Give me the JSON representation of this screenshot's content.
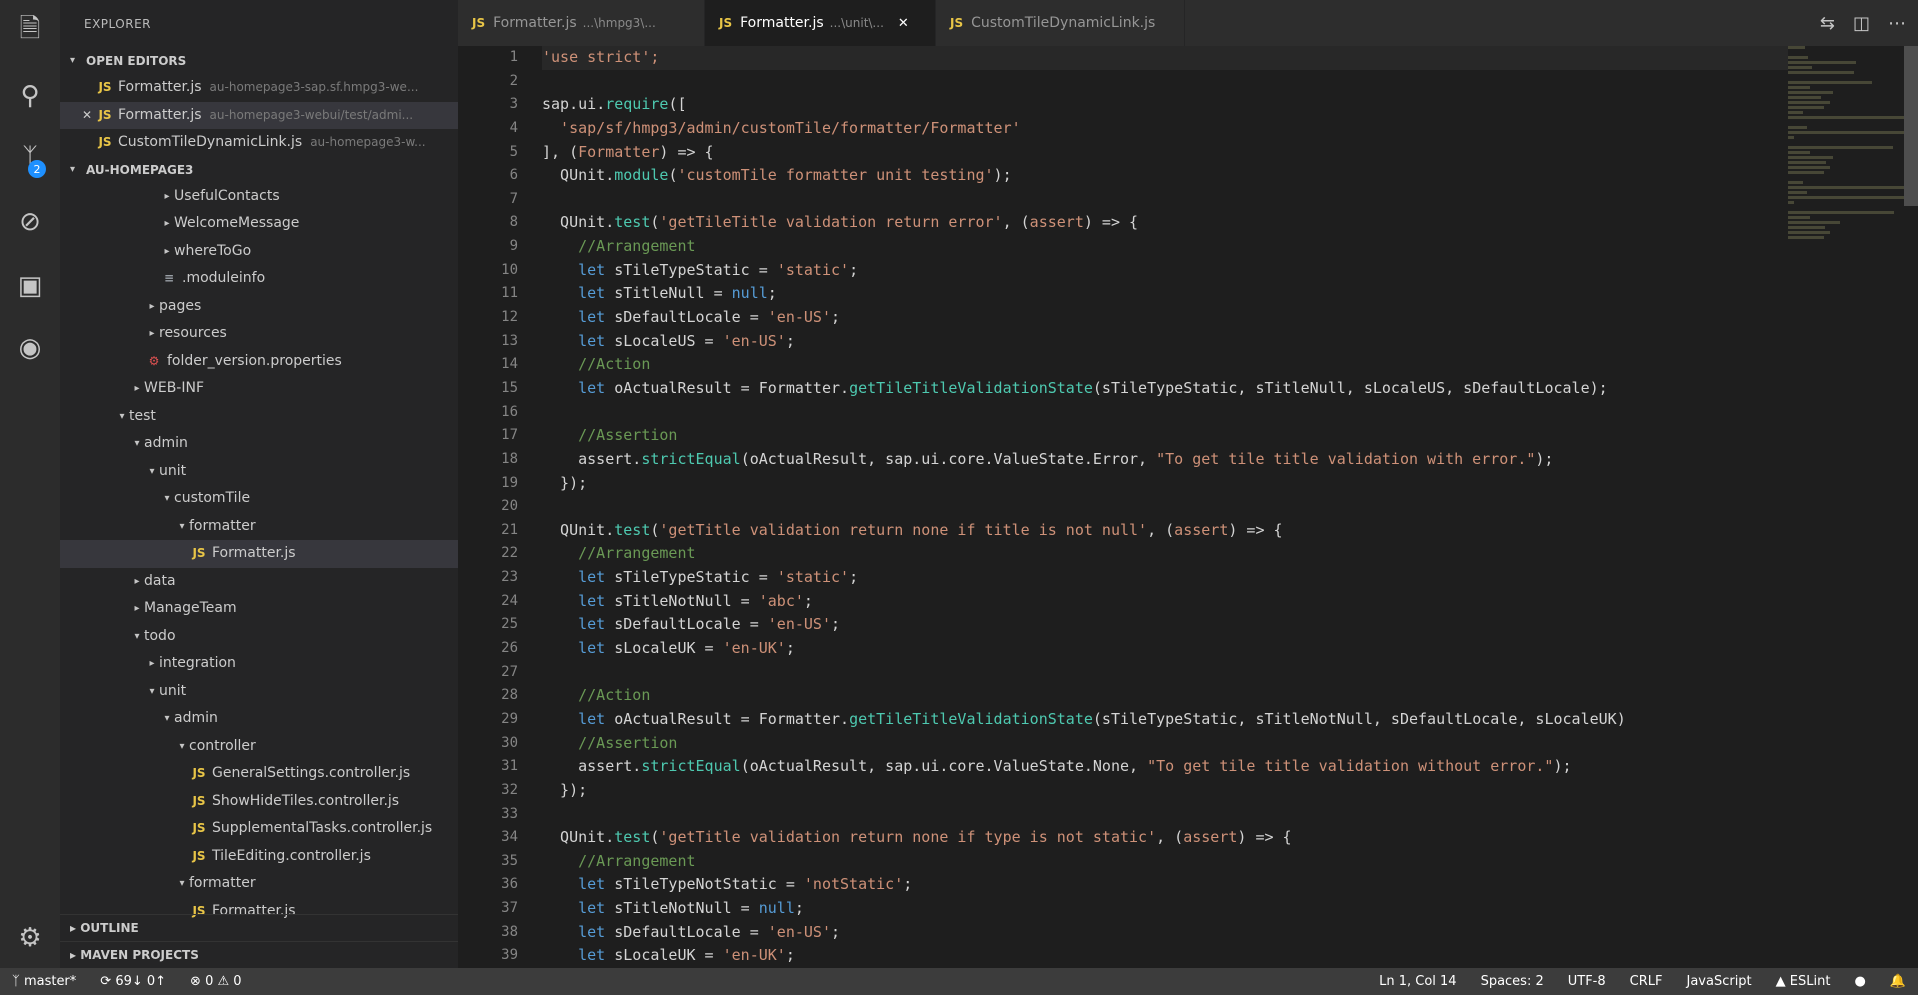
{
  "colors": {
    "keyword": "#569cd6",
    "string": "#ce9178",
    "function": "#dcdcaa",
    "method": "#4ec9b0",
    "param": "#ce9178",
    "comment": "#6a9955",
    "default": "#d4d4d4"
  },
  "activity_bar": {
    "icons": [
      "files-icon",
      "search-icon",
      "source-control-icon",
      "debug-icon",
      "extensions-icon",
      "remote-icon",
      "settings-gear-icon"
    ],
    "badge": "2"
  },
  "sidebar": {
    "title": "EXPLORER",
    "open_editors_label": "OPEN EDITORS",
    "open_editors": [
      {
        "name": "Formatter.js",
        "dir": "au-homepage3-sap.sf.hmpg3-we..."
      },
      {
        "name": "Formatter.js",
        "dir": "au-homepage3-webui/test/admi..."
      },
      {
        "name": "CustomTileDynamicLink.js",
        "dir": "au-homepage3-w..."
      }
    ],
    "project_label": "AU-HOMEPAGE3",
    "tree": [
      {
        "label": "UsefulContacts",
        "twisty": "▸"
      },
      {
        "label": "WelcomeMessage",
        "twisty": "▸"
      },
      {
        "label": "whereToGo",
        "twisty": "▸"
      },
      {
        "label": ".moduleinfo"
      },
      {
        "label": "pages",
        "twisty": "▸"
      },
      {
        "label": "resources",
        "twisty": "▸"
      },
      {
        "label": "folder_version.properties"
      },
      {
        "label": "WEB-INF",
        "twisty": "▸"
      },
      {
        "label": "test",
        "twisty": "▾"
      },
      {
        "label": "admin",
        "twisty": "▾"
      },
      {
        "label": "unit",
        "twisty": "▾"
      },
      {
        "label": "customTile",
        "twisty": "▾"
      },
      {
        "label": "formatter",
        "twisty": "▾"
      },
      {
        "label": "Formatter.js"
      },
      {
        "label": "data",
        "twisty": "▸"
      },
      {
        "label": "ManageTeam",
        "twisty": "▸"
      },
      {
        "label": "todo",
        "twisty": "▾"
      },
      {
        "label": "integration",
        "twisty": "▸"
      },
      {
        "label": "unit",
        "twisty": "▾"
      },
      {
        "label": "admin",
        "twisty": "▾"
      },
      {
        "label": "controller",
        "twisty": "▾"
      },
      {
        "label": "GeneralSettings.controller.js"
      },
      {
        "label": "ShowHideTiles.controller.js"
      },
      {
        "label": "SupplementalTasks.controller.js"
      },
      {
        "label": "TileEditing.controller.js"
      },
      {
        "label": "formatter",
        "twisty": "▾"
      },
      {
        "label": "Formatter.js"
      }
    ],
    "outline_label": "OUTLINE",
    "maven_label": "MAVEN PROJECTS"
  },
  "tabs": [
    {
      "name": "Formatter.js",
      "dir": "...\\hmpg3\\..."
    },
    {
      "name": "Formatter.js",
      "dir": "...\\unit\\..."
    },
    {
      "name": "CustomTileDynamicLink.js",
      "dir": ""
    }
  ],
  "editor": {
    "lines": [
      [
        [
          "'use strict';",
          "string"
        ]
      ],
      [],
      [
        [
          "sap",
          "default"
        ],
        [
          ".",
          "default"
        ],
        [
          "ui",
          "default"
        ],
        [
          ".",
          "default"
        ],
        [
          "require",
          "method"
        ],
        [
          "([",
          "default"
        ]
      ],
      [
        [
          "  'sap/sf/hmpg3/admin/customTile/formatter/Formatter'",
          "string"
        ]
      ],
      [
        [
          "], (",
          "default"
        ],
        [
          "Formatter",
          "param"
        ],
        [
          ") => {",
          "default"
        ]
      ],
      [
        [
          "  QUnit",
          "default"
        ],
        [
          ".",
          "default"
        ],
        [
          "module",
          "method"
        ],
        [
          "(",
          "default"
        ],
        [
          "'customTile formatter unit testing'",
          "string"
        ],
        [
          ");",
          "default"
        ]
      ],
      [],
      [
        [
          "  QUnit",
          "default"
        ],
        [
          ".",
          "default"
        ],
        [
          "test",
          "method"
        ],
        [
          "(",
          "default"
        ],
        [
          "'getTileTitle validation return error'",
          "string"
        ],
        [
          ", (",
          "default"
        ],
        [
          "assert",
          "param"
        ],
        [
          ") => {",
          "default"
        ]
      ],
      [
        [
          "    //Arrangement",
          "comment"
        ]
      ],
      [
        [
          "    let ",
          "keyword"
        ],
        [
          "sTileTypeStatic = ",
          "default"
        ],
        [
          "'static'",
          "string"
        ],
        [
          ";",
          "default"
        ]
      ],
      [
        [
          "    let ",
          "keyword"
        ],
        [
          "sTitleNull = ",
          "default"
        ],
        [
          "null",
          "keyword"
        ],
        [
          ";",
          "default"
        ]
      ],
      [
        [
          "    let ",
          "keyword"
        ],
        [
          "sDefaultLocale = ",
          "default"
        ],
        [
          "'en-US'",
          "string"
        ],
        [
          ";",
          "default"
        ]
      ],
      [
        [
          "    let ",
          "keyword"
        ],
        [
          "sLocaleUS = ",
          "default"
        ],
        [
          "'en-US'",
          "string"
        ],
        [
          ";",
          "default"
        ]
      ],
      [
        [
          "    //Action",
          "comment"
        ]
      ],
      [
        [
          "    let ",
          "keyword"
        ],
        [
          "oActualResult = Formatter.",
          "default"
        ],
        [
          "getTileTitleValidationState",
          "method"
        ],
        [
          "(sTileTypeStatic, sTitleNull, sLocaleUS, sDefaultLocale);",
          "default"
        ]
      ],
      [],
      [
        [
          "    //Assertion",
          "comment"
        ]
      ],
      [
        [
          "    assert.",
          "default"
        ],
        [
          "strictEqual",
          "method"
        ],
        [
          "(oActualResult, sap.ui.core.ValueState.Error, ",
          "default"
        ],
        [
          "\"To get tile title validation with error.\"",
          "string"
        ],
        [
          ");",
          "default"
        ]
      ],
      [
        [
          "  });",
          "default"
        ]
      ],
      [],
      [
        [
          "  QUnit",
          "default"
        ],
        [
          ".",
          "default"
        ],
        [
          "test",
          "method"
        ],
        [
          "(",
          "default"
        ],
        [
          "'getTitle validation return none if title is not null'",
          "string"
        ],
        [
          ", (",
          "default"
        ],
        [
          "assert",
          "param"
        ],
        [
          ") => {",
          "default"
        ]
      ],
      [
        [
          "    //Arrangement",
          "comment"
        ]
      ],
      [
        [
          "    let ",
          "keyword"
        ],
        [
          "sTileTypeStatic = ",
          "default"
        ],
        [
          "'static'",
          "string"
        ],
        [
          ";",
          "default"
        ]
      ],
      [
        [
          "    let ",
          "keyword"
        ],
        [
          "sTitleNotNull = ",
          "default"
        ],
        [
          "'abc'",
          "string"
        ],
        [
          ";",
          "default"
        ]
      ],
      [
        [
          "    let ",
          "keyword"
        ],
        [
          "sDefaultLocale = ",
          "default"
        ],
        [
          "'en-US'",
          "string"
        ],
        [
          ";",
          "default"
        ]
      ],
      [
        [
          "    let ",
          "keyword"
        ],
        [
          "sLocaleUK = ",
          "default"
        ],
        [
          "'en-UK'",
          "string"
        ],
        [
          ";",
          "default"
        ]
      ],
      [],
      [
        [
          "    //Action",
          "comment"
        ]
      ],
      [
        [
          "    let ",
          "keyword"
        ],
        [
          "oActualResult = Formatter.",
          "default"
        ],
        [
          "getTileTitleValidationState",
          "method"
        ],
        [
          "(sTileTypeStatic, sTitleNotNull, sDefaultLocale, sLocaleUK)",
          "default"
        ]
      ],
      [
        [
          "    //Assertion",
          "comment"
        ]
      ],
      [
        [
          "    assert.",
          "default"
        ],
        [
          "strictEqual",
          "method"
        ],
        [
          "(oActualResult, sap.ui.core.ValueState.None, ",
          "default"
        ],
        [
          "\"To get tile title validation without error.\"",
          "string"
        ],
        [
          ");",
          "default"
        ]
      ],
      [
        [
          "  });",
          "default"
        ]
      ],
      [],
      [
        [
          "  QUnit",
          "default"
        ],
        [
          ".",
          "default"
        ],
        [
          "test",
          "method"
        ],
        [
          "(",
          "default"
        ],
        [
          "'getTitle validation return none if type is not static'",
          "string"
        ],
        [
          ", (",
          "default"
        ],
        [
          "assert",
          "param"
        ],
        [
          ") => {",
          "default"
        ]
      ],
      [
        [
          "    //Arrangement",
          "comment"
        ]
      ],
      [
        [
          "    let ",
          "keyword"
        ],
        [
          "sTileTypeNotStatic = ",
          "default"
        ],
        [
          "'notStatic'",
          "string"
        ],
        [
          ";",
          "default"
        ]
      ],
      [
        [
          "    let ",
          "keyword"
        ],
        [
          "sTitleNotNull = ",
          "default"
        ],
        [
          "null",
          "keyword"
        ],
        [
          ";",
          "default"
        ]
      ],
      [
        [
          "    let ",
          "keyword"
        ],
        [
          "sDefaultLocale = ",
          "default"
        ],
        [
          "'en-US'",
          "string"
        ],
        [
          ";",
          "default"
        ]
      ],
      [
        [
          "    let ",
          "keyword"
        ],
        [
          "sLocaleUK = ",
          "default"
        ],
        [
          "'en-UK'",
          "string"
        ],
        [
          ";",
          "default"
        ]
      ]
    ]
  },
  "statusbar": {
    "branch": "master*",
    "sync": "69↓ 0↑",
    "problems": "⊗ 0 ⚠ 0",
    "position": "Ln 1, Col 14",
    "spaces": "Spaces: 2",
    "encoding": "UTF-8",
    "eol": "CRLF",
    "language": "JavaScript",
    "linter": "ESLint"
  }
}
